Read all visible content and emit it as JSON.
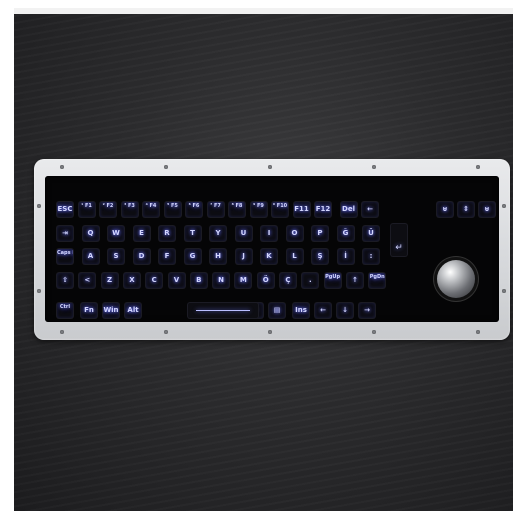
{
  "photo": {
    "description_alt": "",
    "keyboard": {
      "function_row": [
        "ESC",
        "¹ F1",
        "² F2",
        "³ F3",
        "⁴ F4",
        "⁵ F5",
        "⁶ F6",
        "⁷ F7",
        "⁸ F8",
        "⁹ F9",
        "⁰ F10",
        "F11",
        "F12",
        "Del",
        "←"
      ],
      "mouse_keys": [
        "⊍",
        "⇕",
        "⊍"
      ],
      "row_q": [
        "⇥",
        "Q",
        "W",
        "E",
        "R",
        "T",
        "Y",
        "U",
        "I",
        "O",
        "P",
        "Ğ",
        "Ü"
      ],
      "row_a": [
        "Caps Lock",
        "A",
        "S",
        "D",
        "F",
        "G",
        "H",
        "J",
        "K",
        "L",
        "Ş",
        "İ",
        ":"
      ],
      "row_z": [
        "⇧",
        "<",
        "Z",
        "X",
        "C",
        "V",
        "B",
        "N",
        "M",
        "Ö",
        "Ç",
        ".",
        "PgUp",
        "↑",
        "PgDn"
      ],
      "row_bottom": [
        "Ctrl",
        "Fn",
        "Win",
        "Alt",
        "",
        "☀",
        "▤",
        "Ins",
        "←",
        "↓",
        "→"
      ]
    },
    "colors": {
      "backlight": "#6f78ff",
      "background": "#2b2b2d",
      "plate": "#d7d9dc"
    }
  }
}
